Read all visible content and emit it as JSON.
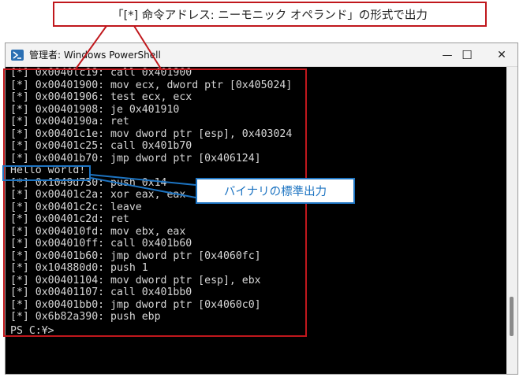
{
  "window": {
    "title": "管理者: Windows PowerShell",
    "controls": {
      "minimize": "—",
      "maximize": "☐",
      "close": "✕"
    }
  },
  "console": {
    "lines": [
      "[*] 0x0040lc19: call 0x401900",
      "[*] 0x00401900: mov ecx, dword ptr [0x405024]",
      "[*] 0x00401906: test ecx, ecx",
      "[*] 0x00401908: je 0x401910",
      "[*] 0x0040190a: ret",
      "[*] 0x00401c1e: mov dword ptr [esp], 0x403024",
      "[*] 0x00401c25: call 0x401b70",
      "[*] 0x00401b70: jmp dword ptr [0x406124]",
      "Hello world!",
      "[*] 0x1049d730: push 0x14",
      "[*] 0x00401c2a: xor eax, eax",
      "[*] 0x00401c2c: leave",
      "[*] 0x00401c2d: ret",
      "[*] 0x004010fd: mov ebx, eax",
      "[*] 0x004010ff: call 0x401b60",
      "[*] 0x00401b60: jmp dword ptr [0x4060fc]",
      "[*] 0x104880d0: push 1",
      "[*] 0x00401104: mov dword ptr [esp], ebx",
      "[*] 0x00401107: call 0x401bb0",
      "[*] 0x00401bb0: jmp dword ptr [0x4060c0]",
      "[*] 0x6b82a390: push ebp",
      "PS C:¥> _"
    ]
  },
  "annotations": {
    "format_callout": "「[*] 命令アドレス: ニーモニック オペランド」の形式で出力",
    "stdout_callout": "バイナリの標準出力"
  },
  "colors": {
    "red": "#c0171c",
    "blue": "#1d74c2",
    "console_text": "#d7d7d7",
    "console_bg": "#000000"
  }
}
